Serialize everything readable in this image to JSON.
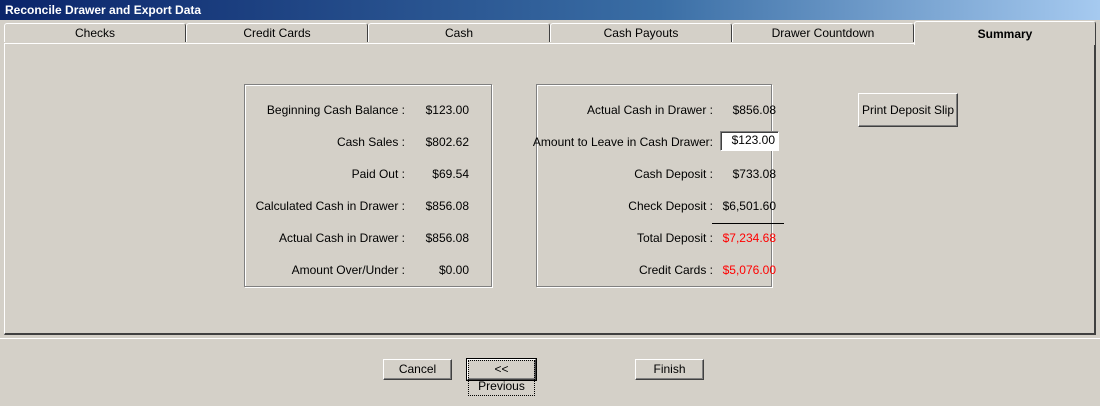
{
  "window": {
    "title": "Reconcile Drawer and Export Data"
  },
  "tabs": [
    {
      "label": "Checks",
      "active": false
    },
    {
      "label": "Credit Cards",
      "active": false
    },
    {
      "label": "Cash",
      "active": false
    },
    {
      "label": "Cash Payouts",
      "active": false
    },
    {
      "label": "Drawer Countdown",
      "active": false
    },
    {
      "label": "Summary",
      "active": true
    }
  ],
  "left_group": {
    "rows": [
      {
        "label": "Beginning Cash Balance :",
        "value": "$123.00"
      },
      {
        "label": "Cash Sales :",
        "value": "$802.62"
      },
      {
        "label": "Paid Out :",
        "value": "$69.54"
      },
      {
        "label": "Calculated Cash in Drawer :",
        "value": "$856.08"
      },
      {
        "label": "Actual Cash in Drawer :",
        "value": "$856.08"
      },
      {
        "label": "Amount Over/Under :",
        "value": "$0.00"
      }
    ]
  },
  "right_group": {
    "rows": [
      {
        "label": "Actual Cash in Drawer :",
        "value": "$856.08"
      },
      {
        "label": "Amount to Leave in Cash Drawer:",
        "value": "$123.00"
      },
      {
        "label": "Cash Deposit :",
        "value": "$733.08"
      },
      {
        "label": "Check Deposit :",
        "value": "$6,501.60"
      },
      {
        "label": "Total Deposit :",
        "value": "$7,234.68"
      },
      {
        "label": "Credit Cards :",
        "value": "$5,076.00"
      }
    ]
  },
  "buttons": {
    "print_deposit_slip": "Print Deposit Slip",
    "cancel": "Cancel",
    "previous": "<< Previous",
    "finish": "Finish"
  },
  "colors": {
    "highlight_value": "#ff0000",
    "title_bar": "#0a246a"
  }
}
